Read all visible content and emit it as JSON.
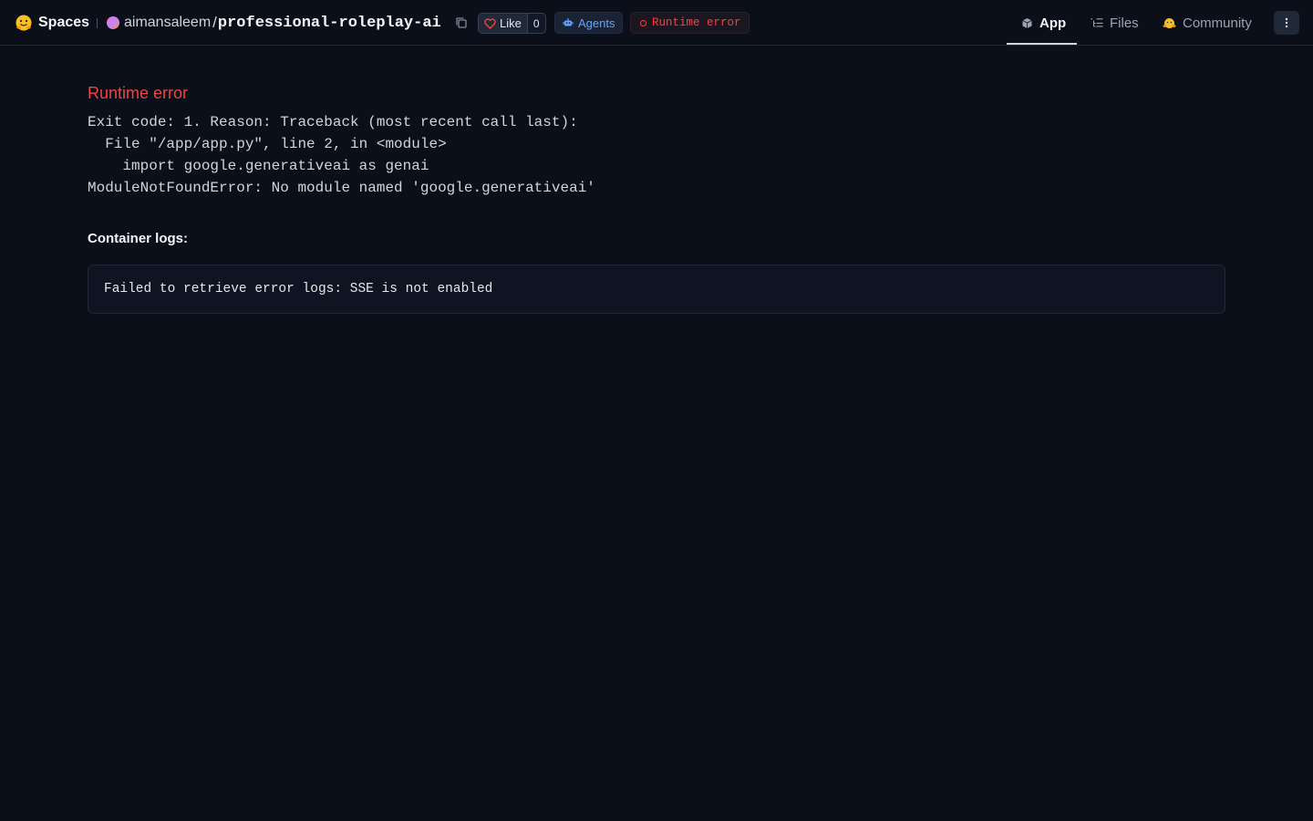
{
  "header": {
    "brand_label": "Spaces",
    "owner": "aimansaleem",
    "separator": "/",
    "repo": "professional-roleplay-ai",
    "like_label": "Like",
    "like_count": "0",
    "agents_label": "Agents",
    "status_label": "Runtime error",
    "tabs": [
      {
        "label": "App",
        "active": true,
        "icon": "cube-icon"
      },
      {
        "label": "Files",
        "active": false,
        "icon": "files-icon"
      },
      {
        "label": "Community",
        "active": false,
        "icon": "community-icon"
      }
    ]
  },
  "main": {
    "error_title": "Runtime error",
    "traceback": "Exit code: 1. Reason: Traceback (most recent call last):\n  File \"/app/app.py\", line 2, in <module>\n    import google.generativeai as genai\nModuleNotFoundError: No module named 'google.generativeai'",
    "logs_label": "Container logs:",
    "logs_text": "Failed to retrieve error logs: SSE is not enabled"
  },
  "colors": {
    "background": "#0b0f19",
    "error": "#ef4444",
    "agents": "#60a5fa",
    "text": "#d1d5db"
  }
}
